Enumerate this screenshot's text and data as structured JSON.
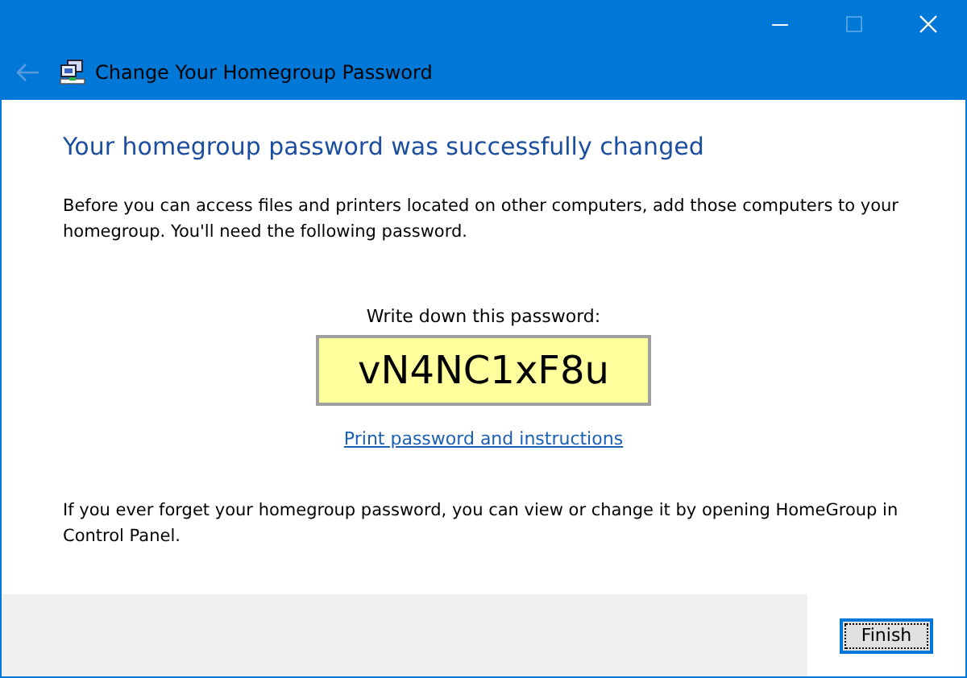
{
  "window": {
    "title": "Change Your Homegroup Password",
    "back_disabled": true,
    "maximize_disabled": true
  },
  "heading": "Your homegroup password was successfully changed",
  "intro": "Before you can access files and printers located on other computers, add those computers to your homegroup. You'll need the following password.",
  "password_label": "Write down this password:",
  "password": "vN4NC1xF8u",
  "print_link": "Print password and instructions",
  "note": "If you ever forget your homegroup password, you can view or change it by opening HomeGroup in Control Panel.",
  "buttons": [
    {
      "label": "Finish",
      "focused": true
    }
  ]
}
